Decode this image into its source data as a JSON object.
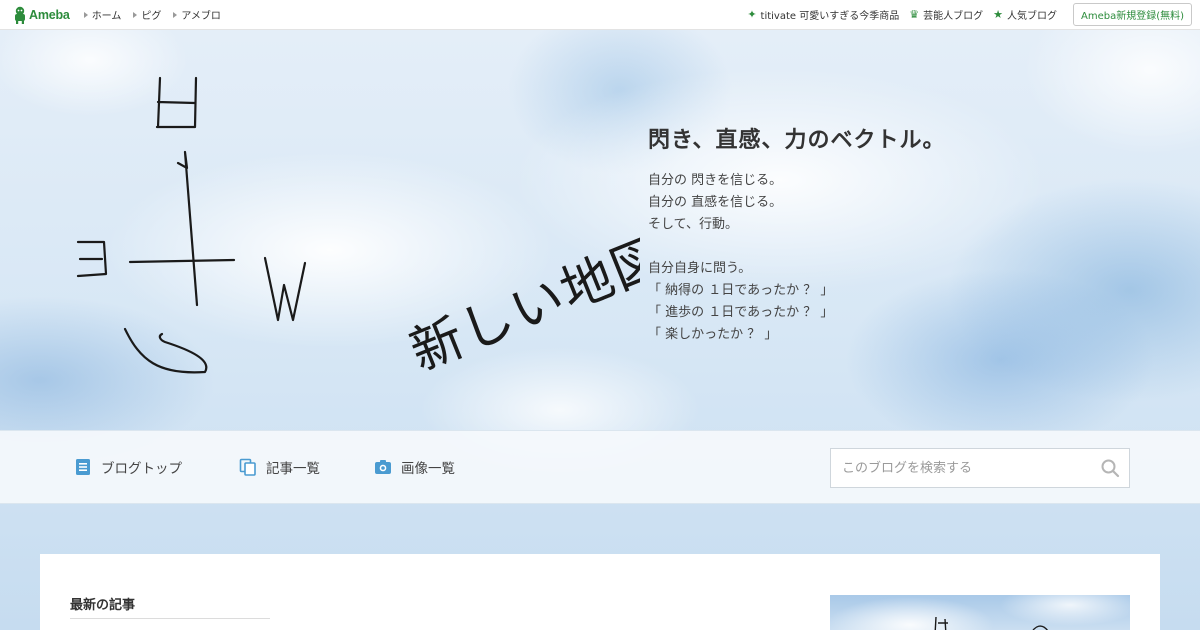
{
  "topbar": {
    "logo_text": "Ameba",
    "nav": [
      {
        "label": "ホーム"
      },
      {
        "label": "ピグ"
      },
      {
        "label": "アメブロ"
      }
    ],
    "right_links": [
      {
        "label": "titivate 可愛いすぎる今季商品",
        "icon": "sparkle-icon",
        "color": "#2d8c3c"
      },
      {
        "label": "芸能人ブログ",
        "icon": "crown-icon",
        "color": "#2d8c3c"
      },
      {
        "label": "人気ブログ",
        "icon": "star-icon",
        "color": "#2d8c3c"
      }
    ],
    "register_label": "Ameba新規登録(無料)"
  },
  "header": {
    "art_text": "新しい地図",
    "title": "閃き、直感、力のベクトル。",
    "description": [
      "自分の 閃きを信じる。",
      "自分の 直感を信じる。",
      "そして、行動。",
      "",
      "自分自身に問う。",
      "「 納得の １日であったか ？ 」",
      "「 進歩の １日であったか ？ 」",
      "「 楽しかったか ？ 」"
    ]
  },
  "blognav": {
    "items": [
      {
        "label": "ブログトップ",
        "icon": "document-icon"
      },
      {
        "label": "記事一覧",
        "icon": "copy-icon"
      },
      {
        "label": "画像一覧",
        "icon": "camera-icon"
      }
    ],
    "search_placeholder": "このブログを検索する"
  },
  "main": {
    "latest_heading": "最新の記事"
  },
  "colors": {
    "accent_green": "#2d8c3c",
    "nav_icon_blue": "#4a9bd1"
  }
}
